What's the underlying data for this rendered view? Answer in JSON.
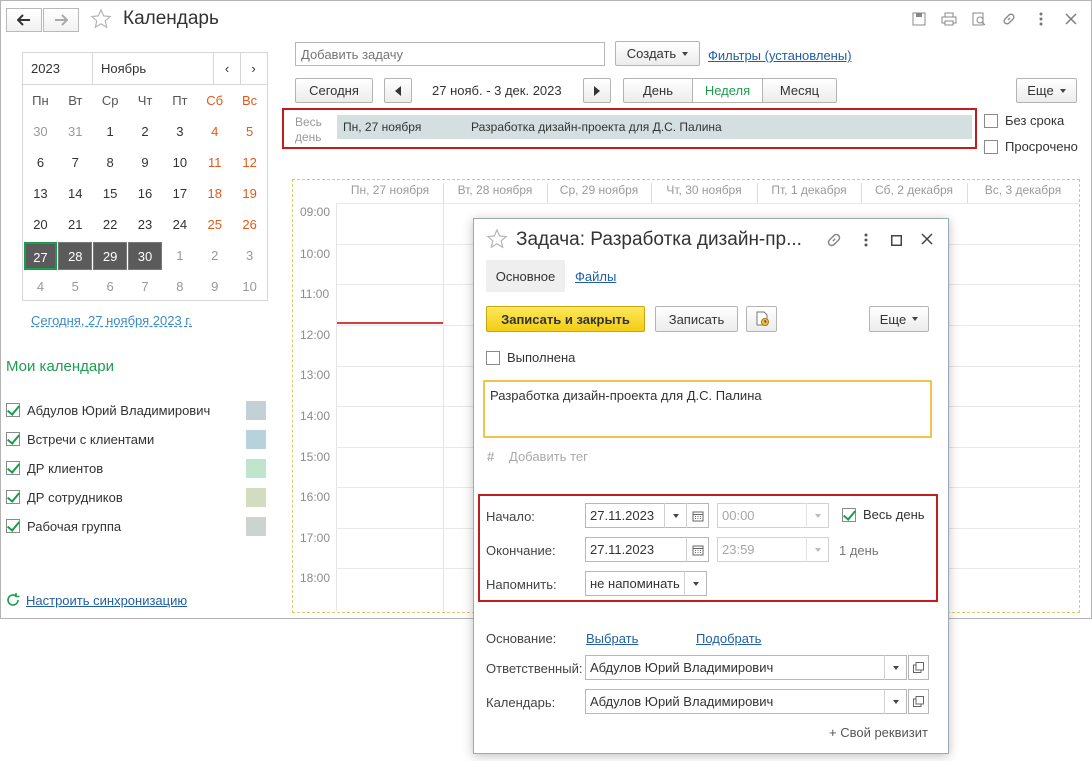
{
  "window": {
    "title": "Календарь"
  },
  "mini_calendar": {
    "year": "2023",
    "month": "Ноябрь",
    "weekdays": [
      "Пн",
      "Вт",
      "Ср",
      "Чт",
      "Пт",
      "Сб",
      "Вс"
    ],
    "weeks": [
      [
        "30",
        "31",
        "1",
        "2",
        "3",
        "4",
        "5"
      ],
      [
        "6",
        "7",
        "8",
        "9",
        "10",
        "11",
        "12"
      ],
      [
        "13",
        "14",
        "15",
        "16",
        "17",
        "18",
        "19"
      ],
      [
        "20",
        "21",
        "22",
        "23",
        "24",
        "25",
        "26"
      ],
      [
        "27",
        "28",
        "29",
        "30",
        "1",
        "2",
        "3"
      ],
      [
        "4",
        "5",
        "6",
        "7",
        "8",
        "9",
        "10"
      ]
    ],
    "today_link": "Сегодня, 27 ноября 2023 г."
  },
  "my_calendars": {
    "title": "Мои календари",
    "items": [
      {
        "label": "Абдулов Юрий Владимирович",
        "color": "#c3d0d6"
      },
      {
        "label": "Встречи с клиентами",
        "color": "#b7d2da"
      },
      {
        "label": "ДР клиентов",
        "color": "#bfe6cc"
      },
      {
        "label": "ДР сотрудников",
        "color": "#d3dbc0"
      },
      {
        "label": "Рабочая группа",
        "color": "#cdd3cf"
      }
    ],
    "sync_link": "Настроить синхронизацию"
  },
  "toolbar": {
    "add_task_placeholder": "Добавить задачу",
    "create_label": "Создать",
    "filters_link": "Фильтры (установлены)",
    "today_button": "Сегодня",
    "period": "27 нояб. - 3 дек. 2023",
    "view_day": "День",
    "view_week": "Неделя",
    "view_month": "Месяц",
    "more_label": "Еще"
  },
  "allday": {
    "label_line1": "Весь",
    "label_line2": "день",
    "event_date": "Пн, 27 ноября",
    "event_title": "Разработка дизайн-проекта для Д.С. Палина"
  },
  "side_filters": {
    "no_deadline": "Без срока",
    "overdue": "Просрочено"
  },
  "week_grid": {
    "days": [
      "Пн, 27 ноября",
      "Вт, 28 ноября",
      "Ср, 29 ноября",
      "Чт, 30 ноября",
      "Пт, 1 декабря",
      "Сб, 2 декабря",
      "Вс, 3 декабря"
    ],
    "hours": [
      "09:00",
      "10:00",
      "11:00",
      "12:00",
      "13:00",
      "14:00",
      "15:00",
      "16:00",
      "17:00",
      "18:00"
    ]
  },
  "task_dialog": {
    "title": "Задача: Разработка дизайн-пр...",
    "tab_main": "Основное",
    "tab_files": "Файлы",
    "save_close": "Записать и закрыть",
    "save": "Записать",
    "more": "Еще",
    "done_label": "Выполнена",
    "description": "Разработка дизайн-проекта для Д.С. Палина",
    "add_tag_symbol": "#",
    "add_tag_placeholder": "Добавить тег",
    "start_label": "Начало:",
    "start_date": "27.11.2023",
    "start_time": "00:00",
    "all_day_label": "Весь день",
    "end_label": "Окончание:",
    "end_date": "27.11.2023",
    "end_time": "23:59",
    "duration": "1 день",
    "remind_label": "Напомнить:",
    "remind_value": "не напоминать",
    "basis_label": "Основание:",
    "basis_select": "Выбрать",
    "basis_pick": "Подобрать",
    "responsible_label": "Ответственный:",
    "responsible_value": "Абдулов Юрий Владимирович",
    "calendar_label": "Календарь:",
    "calendar_value": "Абдулов Юрий Владимирович",
    "custom_attr": "+ Свой реквизит"
  }
}
